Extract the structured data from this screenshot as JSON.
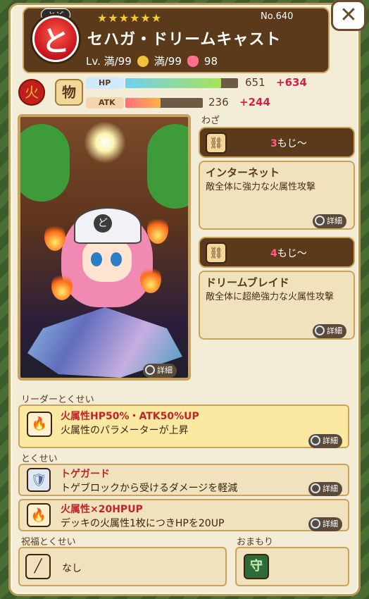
{
  "header": {
    "kana_ruby": "とど",
    "kana": "と",
    "stars": "★★★★★★",
    "number": "No.640",
    "name": "セハガ・ドリームキャスト",
    "level": "Lv. 満/99",
    "skill_level": "満/99",
    "hearts": "98"
  },
  "badges": {
    "element": "火",
    "type": "物"
  },
  "stats": {
    "hp_label": "HP",
    "hp_value": "651",
    "hp_plus": "+634",
    "atk_label": "ATK",
    "atk_value": "236",
    "atk_plus": "+244",
    "hp_fill": 0.85,
    "atk_fill": 0.45
  },
  "portrait": {
    "helm_mark": "ど",
    "detail_label": "詳細"
  },
  "waza": {
    "title": "わざ",
    "skills": [
      {
        "moji_count": "3",
        "moji_suffix": "もじ～",
        "name": "インターネット",
        "desc": "敵全体に強力な火属性攻撃",
        "detail": "詳細"
      },
      {
        "moji_count": "4",
        "moji_suffix": "もじ～",
        "name": "ドリームブレイド",
        "desc": "敵全体に超絶強力な火属性攻撃",
        "detail": "詳細"
      }
    ]
  },
  "leader": {
    "title": "リーダーとくせい",
    "name": "火属性HP50%・ATK50%UP",
    "desc": "火属性のパラメーターが上昇",
    "detail": "詳細"
  },
  "tokusei": {
    "title": "とくせい",
    "items": [
      {
        "name": "トゲガード",
        "desc": "トゲブロックから受けるダメージを軽減",
        "detail": "詳細"
      },
      {
        "name": "火属性×20HPUP",
        "desc": "デッキの火属性1枚につきHPを20UP",
        "detail": "詳細"
      }
    ]
  },
  "blessing": {
    "title": "祝福とくせい",
    "value": "なし"
  },
  "charm": {
    "title": "おまもり",
    "icon_char": "守"
  },
  "icons": {
    "close": "close-icon",
    "heart": "heart-icon",
    "skill": "chain-icon",
    "magnifier": "magnifier-icon"
  },
  "colors": {
    "header_bg": "#5b3a1c",
    "panel_bg": "#f3ecd6",
    "hp_bar": "#6fd0f0",
    "atk_bar": "#ff6f7a",
    "plus_text": "#d1234a",
    "leader_box": "#fbe9a2"
  }
}
